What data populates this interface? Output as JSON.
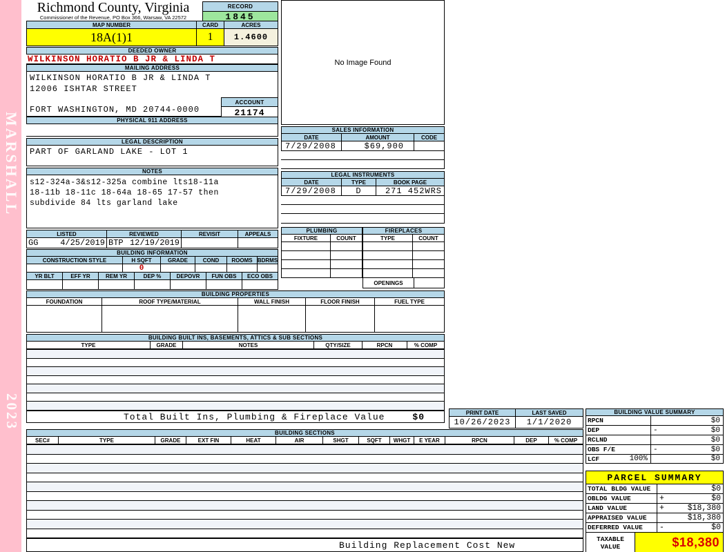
{
  "sidebar": {
    "vendor": "MARSHALL",
    "year": "2023"
  },
  "header": {
    "title": "Richmond County, Virginia",
    "subtitle": "Commissioner of the Revenue, PO Box 366, Warsaw, VA 22572",
    "record_label": "RECORD",
    "record_value": "1845",
    "map_number_label": "MAP NUMBER",
    "map_number": "18A(1)1",
    "card_label": "CARD",
    "card_value": "1",
    "acres_label": "ACRES",
    "acres_value": "1.4600"
  },
  "owner": {
    "deeded_owner_label": "DEEDED OWNER",
    "deeded_owner": "WILKINSON HORATIO B JR & LINDA T",
    "mailing_address_label": "MAILING ADDRESS",
    "mailing_lines": [
      "WILKINSON HORATIO B JR & LINDA T",
      "12006 ISHTAR STREET",
      "FORT WASHINGTON, MD 20744-0000"
    ],
    "account_label": "ACCOUNT",
    "account_value": "21174",
    "physical_address_label": "PHYSICAL 911 ADDRESS",
    "physical_address": ""
  },
  "legal_description": {
    "label": "LEGAL DESCRIPTION",
    "value": "PART OF GARLAND LAKE - LOT 1"
  },
  "notes": {
    "label": "NOTES",
    "lines": [
      "s12-324a-3&s12-325a combine lts18-11a",
      "18-11b 18-11c 18-64a 18-65 17-57 then",
      "subdivide 84 lts garland lake"
    ]
  },
  "review": {
    "listed_label": "LISTED",
    "listed_by": "GG",
    "listed_date": "4/25/2019",
    "reviewed_label": "REVIEWED",
    "reviewed_by": "BTP",
    "reviewed_date": "12/19/2019",
    "revisit_label": "REVISIT",
    "appeals_label": "APPEALS"
  },
  "building_information": {
    "label": "BUILDING INFORMATION",
    "row1_headers": [
      "CONSTRUCTION STYLE",
      "H SQFT",
      "GRADE",
      "COND",
      "ROOMS",
      "BDRMS"
    ],
    "h_sqft_value": "0",
    "row2_headers": [
      "YR BLT",
      "EFF YR",
      "REM YR",
      "DEP %",
      "DEPOVR",
      "FUN OBS",
      "ECO OBS"
    ]
  },
  "image_panel": {
    "message": "No Image Found"
  },
  "sales_information": {
    "label": "SALES INFORMATION",
    "headers": [
      "DATE",
      "AMOUNT",
      "CODE"
    ],
    "rows": [
      [
        "7/29/2008",
        "$69,900",
        ""
      ]
    ]
  },
  "legal_instruments": {
    "label": "LEGAL INSTRUMENTS",
    "headers": [
      "DATE",
      "TYPE",
      "BOOK PAGE"
    ],
    "rows": [
      [
        "7/29/2008",
        "D",
        "271 452WRS"
      ]
    ]
  },
  "plumbing": {
    "label": "PLUMBING",
    "headers": [
      "FIXTURE",
      "COUNT"
    ]
  },
  "fireplaces": {
    "label": "FIREPLACES",
    "headers": [
      "TYPE",
      "COUNT"
    ],
    "openings_label": "OPENINGS"
  },
  "building_properties": {
    "label": "BUILDING PROPERTIES",
    "headers": [
      "FOUNDATION",
      "ROOF TYPE/MATERIAL",
      "WALL FINISH",
      "FLOOR FINISH",
      "FUEL TYPE"
    ]
  },
  "built_ins": {
    "label": "BUILDING BUILT INS, BASEMENTS, ATTICS & SUB SECTIONS",
    "headers": [
      "TYPE",
      "GRADE",
      "NOTES",
      "QTY/SIZE",
      "RPCN",
      "% COMP"
    ],
    "total_label": "Total Built Ins, Plumbing & Fireplace Value",
    "total_value": "$0"
  },
  "print_info": {
    "print_date_label": "PRINT DATE",
    "print_date": "10/26/2023",
    "last_saved_label": "LAST SAVED",
    "last_saved": "1/1/2020"
  },
  "building_value_summary": {
    "label": "BUILDING VALUE SUMMARY",
    "rows": [
      {
        "label": "RPCN",
        "op": "",
        "value": "$0"
      },
      {
        "label": "DEP",
        "op": "-",
        "value": "$0"
      },
      {
        "label": "RCLND",
        "op": "",
        "value": "$0"
      },
      {
        "label": "OBS F/E",
        "op": "-",
        "value": "$0"
      },
      {
        "label": "LCF",
        "pct": "100%",
        "op": "",
        "value": "$0"
      }
    ]
  },
  "building_sections": {
    "label": "BUILDING SECTIONS",
    "headers": [
      "SEC#",
      "TYPE",
      "GRADE",
      "EXT FIN",
      "HEAT",
      "AIR",
      "SHGT",
      "SQFT",
      "WHGT",
      "E YEAR",
      "RPCN",
      "DEP",
      "% COMP"
    ],
    "footer": "Building Replacement Cost New"
  },
  "parcel_summary": {
    "label": "PARCEL SUMMARY",
    "rows": [
      {
        "label": "TOTAL BLDG VALUE",
        "op": "",
        "value": "$0"
      },
      {
        "label": "OBLDG VALUE",
        "op": "+",
        "value": "$0"
      },
      {
        "label": "LAND VALUE",
        "op": "+",
        "value": "$18,380"
      },
      {
        "label": "APPRAISED VALUE",
        "op": "",
        "value": "$18,380"
      },
      {
        "label": "DEFERRED VALUE",
        "op": "-",
        "value": "$0"
      }
    ],
    "taxable_label": "TAXABLE VALUE",
    "taxable_value": "$18,380"
  },
  "colors": {
    "header_blue": "#B5D7E8",
    "highlight_yellow": "#FFFF00",
    "record_green": "#9DE69D",
    "acres_cream": "#F4F1DE",
    "sidebar_pink": "#FFBFCD",
    "alert_red": "#C00000",
    "row_alt": "#F1F4F9"
  }
}
